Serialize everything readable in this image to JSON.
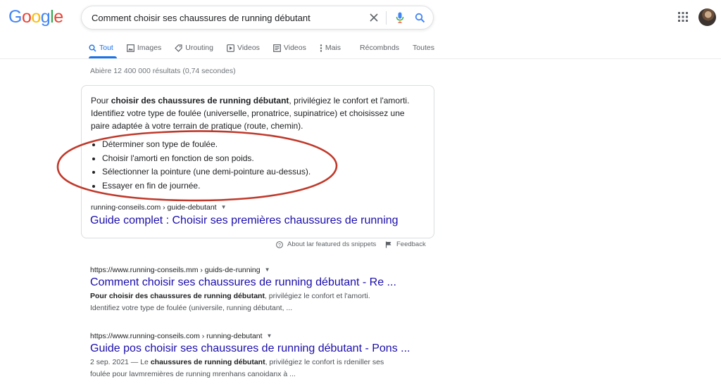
{
  "header": {
    "logo": [
      "G",
      "o",
      "o",
      "g",
      "l",
      "e"
    ],
    "logo_colors": [
      "#4285F4",
      "#EA4335",
      "#FBBC05",
      "#4285F4",
      "#34A853",
      "#EA4335"
    ],
    "query": "Comment choisir ses chaussures de running débutant",
    "icons": [
      "close-icon",
      "mic-icon",
      "search-icon",
      "apps-grid-icon",
      "avatar"
    ]
  },
  "tabs": [
    {
      "label": "Tout",
      "icon": "search-icon",
      "active": true
    },
    {
      "label": "Images",
      "icon": "image-icon"
    },
    {
      "label": "Urouting",
      "icon": "tag-icon"
    },
    {
      "label": "Videos",
      "icon": "video-icon"
    },
    {
      "label": "Videos",
      "icon": "news-icon"
    },
    {
      "label": "Mais",
      "icon": "more-icon"
    },
    {
      "label": "Récombnds"
    },
    {
      "label": "Toutes"
    }
  ],
  "result_stats": "Abière 12 400 000 résultats (0,74 secondes)",
  "snippet": {
    "text_pre": "Pour ",
    "text_bold": "choisir des chaussures de running débutant",
    "text_post": ", privilégiez le confort et l'amorti. Identifiez votre type de foulée (universelle, pronatrice, supinatrice) et choisissez une paire adaptée à votre terrain de pratique (route, chemin).",
    "bullets": [
      "Déterminer son type de foulée.",
      "Choisir l'amorti en fonction de son poids.",
      "Sélectionner la pointure (une demi-pointure au-dessus).",
      "Essayer en fin de journée."
    ],
    "cite": "running-conseils.com › guide-debutant",
    "title": "Guide complet : Choisir ses premières chaussures de running",
    "ellipse_color": "#c0392b"
  },
  "about": "About lar featured ds snippets",
  "feedback": "Feedback",
  "results": [
    {
      "cite": "https://www.running-conseils.mm › guids-de-running",
      "title": "Comment choisir ses chaussures de running débutant - Re ...",
      "desc_bold": "Pour choisir des chaussures de running débutant",
      "desc_rest": ", privilégiez le confort et l'amorti.",
      "desc_line2": "Identifiez votre type de foulée (universile, running débutant, ..."
    },
    {
      "cite": "https://www.running-conseils.com › running-debutant",
      "title": "Guide pos choisir ses chaussures de running débutant - Pons ...",
      "desc_pre": "2 sep. 2021 — Le ",
      "desc_bold": "chaussures de running débutant",
      "desc_rest": ", privilégiez le confort is rdeniller ses",
      "desc_line2": "foulée pour lavmremières de running mrenhans canoidanx à ..."
    }
  ],
  "colors": {
    "link": "#1a0dab",
    "accent": "#1a73e8",
    "muted": "#70757a"
  }
}
